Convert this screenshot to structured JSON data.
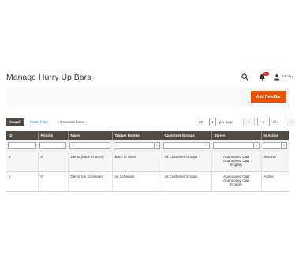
{
  "header": {
    "title": "Manage Hurry Up Bars",
    "notification_count": "10",
    "username": "admin",
    "icons": [
      "search-icon",
      "bell-icon",
      "user-icon",
      "caret-down-icon"
    ]
  },
  "actions": {
    "add_label": "Add New Bar",
    "accent_color": "#eb5202"
  },
  "toolbar": {
    "search_label": "Search",
    "reset_label": "Reset Filter",
    "records_found": "2 records found",
    "per_page_value": "20",
    "per_page_label": "per page",
    "current_page": "1",
    "of_total": "of 1"
  },
  "grid": {
    "columns": [
      "ID",
      "Priority",
      "Name",
      "Trigger Events",
      "Customer Groups",
      "Stores",
      "Is Active"
    ],
    "sort_indicator": "↑",
    "rows": [
      {
        "id": "2",
        "priority": "0",
        "name": "Demo (back to store)",
        "trigger": "Back to Store",
        "groups": "All Customer Groups",
        "stores": [
          "Abandoned Cart",
          "Abandoned Cart",
          "English"
        ],
        "active": "Inactive"
      },
      {
        "id": "1",
        "priority": "0",
        "name": "Demo (on schedule)",
        "trigger": "on Schedule",
        "groups": "All Customer Groups",
        "stores": [
          "Abandoned Cart",
          "Abandoned Cart",
          "English"
        ],
        "active": "Active"
      }
    ]
  }
}
